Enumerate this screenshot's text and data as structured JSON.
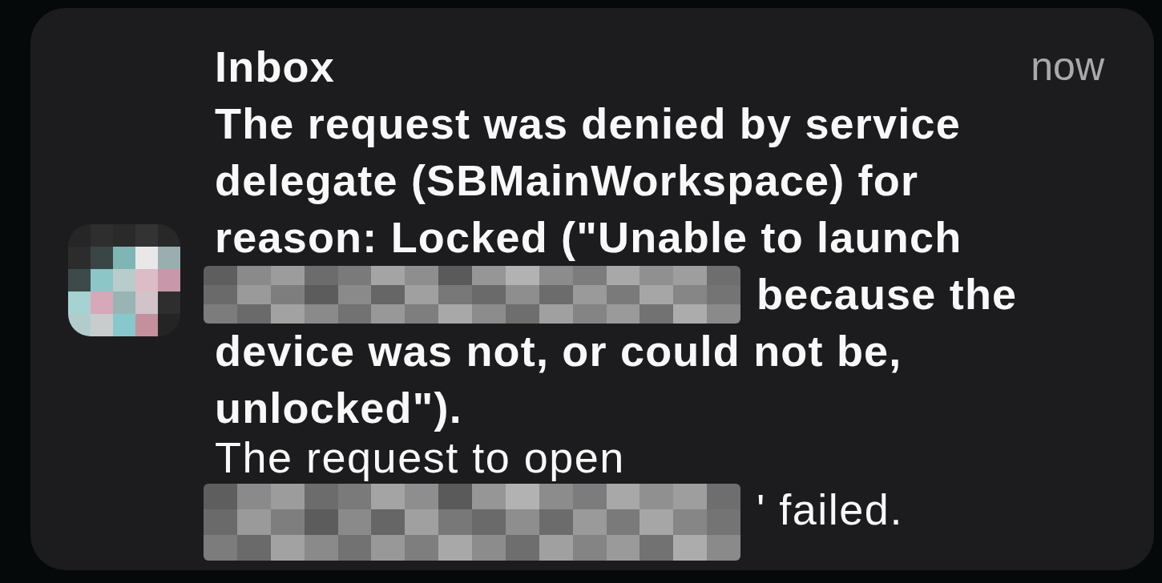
{
  "notification": {
    "title": "Inbox",
    "time": "now",
    "paragraphs": [
      {
        "bold": true,
        "lines": [
          [
            {
              "kind": "text",
              "text": "The request was denied by service"
            }
          ],
          [
            {
              "kind": "text",
              "text": "delegate (SBMainWorkspace) for"
            }
          ],
          [
            {
              "kind": "text",
              "text": "reason: Locked (\"Unable to launch"
            }
          ],
          [
            {
              "kind": "redacted"
            },
            {
              "kind": "text",
              "text": "because the"
            }
          ],
          [
            {
              "kind": "text",
              "text": "device was not, or could not be,"
            }
          ],
          [
            {
              "kind": "text",
              "text": "unlocked\")."
            }
          ]
        ]
      },
      {
        "bold": false,
        "lines": [
          [
            {
              "kind": "text",
              "text": "The request to open"
            }
          ],
          [
            {
              "kind": "redacted"
            },
            {
              "kind": "text",
              "text": "' failed."
            }
          ]
        ]
      }
    ]
  }
}
